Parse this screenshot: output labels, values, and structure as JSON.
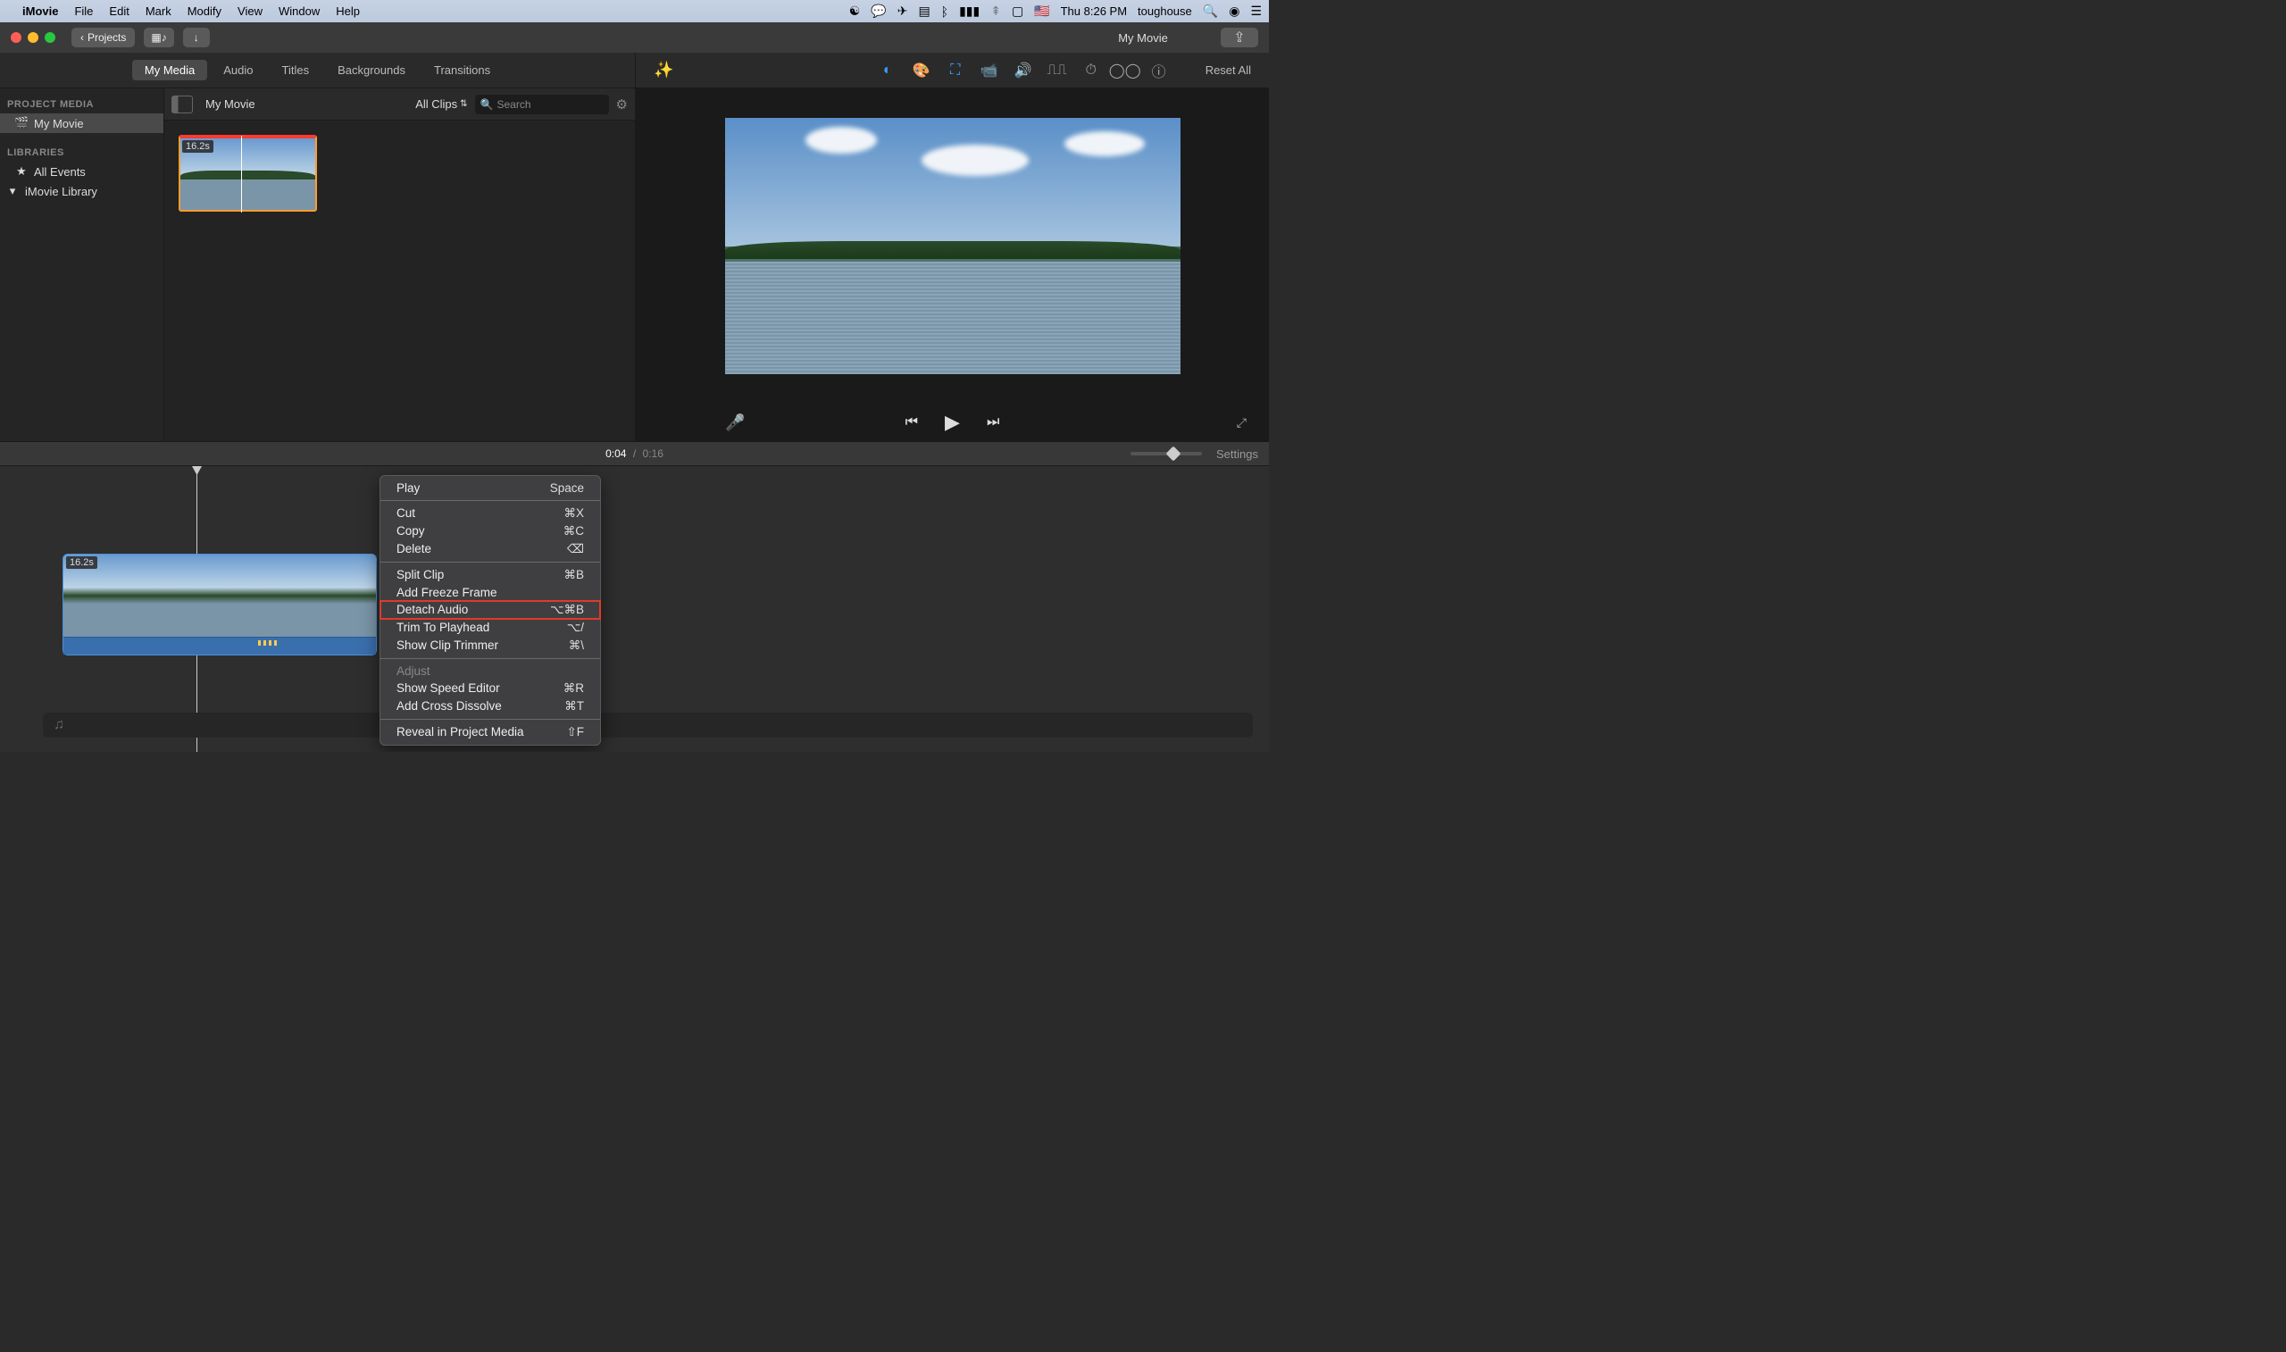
{
  "menubar": {
    "app_name": "iMovie",
    "menus": [
      "File",
      "Edit",
      "Mark",
      "Modify",
      "View",
      "Window",
      "Help"
    ],
    "clock": "Thu 8:26 PM",
    "user": "toughouse"
  },
  "titlebar": {
    "window_title": "My Movie",
    "back_label": "Projects"
  },
  "tabs": {
    "items": [
      "My Media",
      "Audio",
      "Titles",
      "Backgrounds",
      "Transitions"
    ],
    "active_index": 0,
    "reset_label": "Reset All"
  },
  "sidebar": {
    "project_media_header": "PROJECT MEDIA",
    "project_item": "My Movie",
    "libraries_header": "LIBRARIES",
    "all_events": "All Events",
    "library": "iMovie Library"
  },
  "browser": {
    "project_name": "My Movie",
    "filter_label": "All Clips",
    "search_placeholder": "Search",
    "clip_duration": "16.2s"
  },
  "viewer": {
    "timecode_current": "0:04",
    "timecode_sep": "/",
    "timecode_total": "0:16"
  },
  "timeline": {
    "clip_duration": "16.2s",
    "settings_label": "Settings"
  },
  "context_menu": {
    "items": [
      {
        "label": "Play",
        "shortcut": "Space",
        "highlighted": false
      },
      {
        "sep": true
      },
      {
        "label": "Cut",
        "shortcut": "⌘X"
      },
      {
        "label": "Copy",
        "shortcut": "⌘C"
      },
      {
        "label": "Delete",
        "shortcut": "⌫"
      },
      {
        "sep": true
      },
      {
        "label": "Split Clip",
        "shortcut": "⌘B"
      },
      {
        "label": "Add Freeze Frame",
        "shortcut": ""
      },
      {
        "label": "Detach Audio",
        "shortcut": "⌥⌘B",
        "highlighted": true
      },
      {
        "label": "Trim To Playhead",
        "shortcut": "⌥/"
      },
      {
        "label": "Show Clip Trimmer",
        "shortcut": "⌘\\"
      },
      {
        "sep": true
      },
      {
        "label": "Adjust",
        "shortcut": "",
        "disabled": true
      },
      {
        "label": "Show Speed Editor",
        "shortcut": "⌘R"
      },
      {
        "label": "Add Cross Dissolve",
        "shortcut": "⌘T"
      },
      {
        "sep": true
      },
      {
        "label": "Reveal in Project Media",
        "shortcut": "⇧F"
      }
    ]
  }
}
